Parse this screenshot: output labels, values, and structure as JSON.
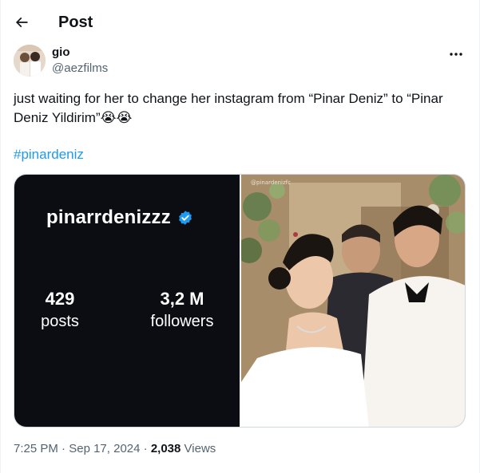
{
  "header": {
    "title": "Post",
    "back_icon": "arrow-left-icon"
  },
  "author": {
    "name": "gio",
    "handle": "@aezfilms",
    "avatar_icon": "user-avatar"
  },
  "more_icon": "more-horizontal-icon",
  "tweet": {
    "text_main": "just waiting for her to change her instagram from “Pinar Deniz” to “Pinar Deniz Yildirim”",
    "emoji": "😭😭",
    "hashtag": "#pinardeniz"
  },
  "media": {
    "instagram_card": {
      "username": "pinarrdenizzz",
      "verified_icon": "verified-badge-icon",
      "posts_count": "429",
      "posts_label": "posts",
      "followers_count": "3,2 M",
      "followers_label": "followers"
    },
    "photo": {
      "watermark": "@pinardenizfc",
      "description_icon": "wedding-photo"
    }
  },
  "meta": {
    "time": "7:25 PM",
    "separator": "·",
    "date": "Sep 17, 2024",
    "views_count": "2,038",
    "views_label": "Views"
  },
  "colors": {
    "text": "#0f1419",
    "secondary": "#536471",
    "link": "#1d9bf0",
    "card_bg": "#0b0d12",
    "verified": "#1d9bf0"
  }
}
